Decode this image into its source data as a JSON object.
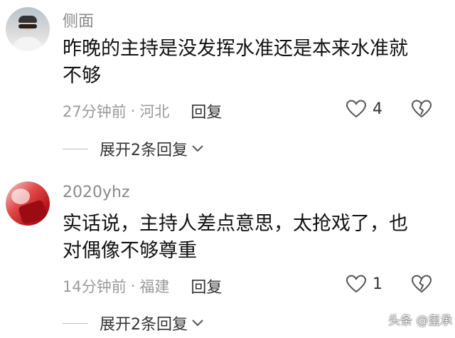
{
  "comments": [
    {
      "username": "侧面",
      "text_line1": "昨晚的主持是没发挥水准还是本来水准就",
      "text_line2": "不够",
      "time": "27分钟前",
      "separator": "·",
      "location": "河北",
      "reply_label": "回复",
      "like_count": "4",
      "expand_label": "展开2条回复"
    },
    {
      "username": "2020yhz",
      "text_line1": "实话说，主持人差点意思，太抢戏了，也",
      "text_line2": "对偶像不够尊重",
      "time": "14分钟前",
      "separator": "·",
      "location": "福建",
      "reply_label": "回复",
      "like_count": "1",
      "expand_label": "展开2条回复"
    }
  ],
  "watermark": "头条 @玺承",
  "colors": {
    "username": "#8a8a8a",
    "meta": "#9a9a9a",
    "text": "#111111"
  },
  "icons": [
    "heart-icon",
    "broken-heart-icon",
    "chevron-down-icon"
  ]
}
